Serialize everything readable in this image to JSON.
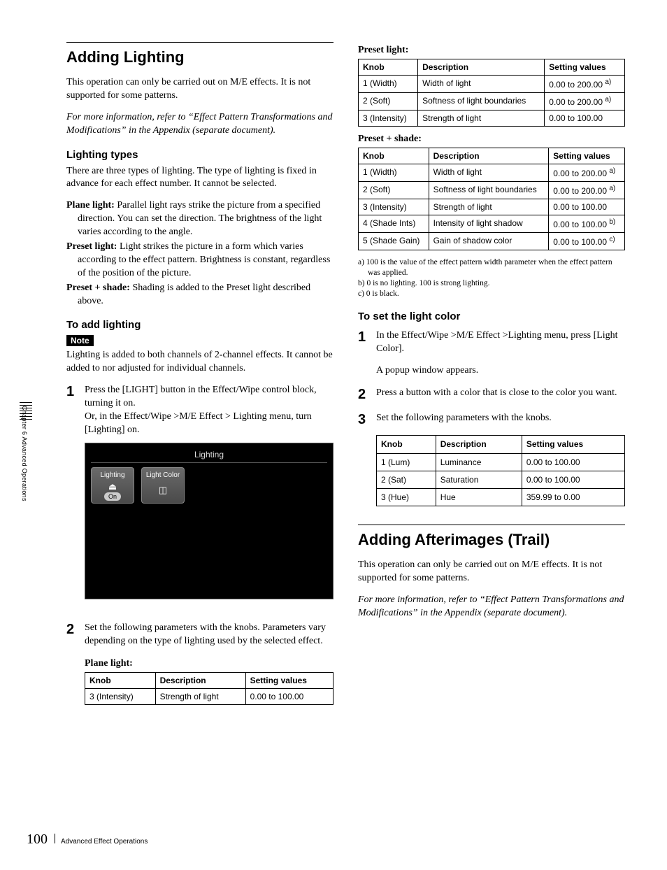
{
  "page_number": "100",
  "footer_text": "Advanced Effect Operations",
  "side_tab": "Chapter 6   Advanced Operations",
  "left": {
    "section_title": "Adding Lighting",
    "intro1": "This operation can only be carried out on M/E effects. It is not supported for some patterns.",
    "intro_italic": "For more information, refer to “Effect Pattern Transformations and Modifications” in the Appendix (separate document).",
    "lighting_types_title": "Lighting types",
    "lighting_types_intro": "There are three types of lighting. The type of lighting is fixed in advance for each effect number. It cannot be selected.",
    "defs": [
      {
        "term": "Plane light:",
        "desc": " Parallel light rays strike the picture from a specified direction. You can set the direction. The brightness of the light varies according to the angle."
      },
      {
        "term": "Preset light:",
        "desc": " Light strikes the picture in a form which varies according to the effect pattern. Brightness is constant, regardless of the position of the picture."
      },
      {
        "term": "Preset + shade:",
        "desc": " Shading is added to the Preset light described above."
      }
    ],
    "to_add_title": "To add lighting",
    "note_label": "Note",
    "note_body": "Lighting is added to both channels of 2-channel effects. It cannot be added to nor adjusted for individual channels.",
    "step1_a": "Press the [LIGHT] button in the Effect/Wipe control block, turning it on.",
    "step1_b": "Or, in the Effect/Wipe >M/E Effect > Lighting menu, turn [Lighting] on.",
    "ui": {
      "title": "Lighting",
      "btn1_label": "Lighting",
      "btn1_state": "On",
      "btn2_label": "Light Color"
    },
    "step2": "Set the following parameters with the knobs. Parameters vary depending on the type of lighting used by the selected effect.",
    "plane_caption": "Plane light:",
    "table_headers": [
      "Knob",
      "Description",
      "Setting values"
    ],
    "plane_rows": [
      {
        "k": "3 (Intensity)",
        "d": "Strength of light",
        "v": "0.00 to 100.00"
      }
    ]
  },
  "right": {
    "preset_caption": "Preset light:",
    "preset_rows": [
      {
        "k": "1 (Width)",
        "d": "Width of light",
        "v": "0.00 to 200.00 ",
        "sup": "a)"
      },
      {
        "k": "2 (Soft)",
        "d": "Softness of light boundaries",
        "v": "0.00 to 200.00 ",
        "sup": "a)"
      },
      {
        "k": "3 (Intensity)",
        "d": "Strength of light",
        "v": "0.00 to 100.00"
      }
    ],
    "preset_shade_caption": "Preset + shade:",
    "preset_shade_rows": [
      {
        "k": "1 (Width)",
        "d": "Width of light",
        "v": "0.00 to 200.00 ",
        "sup": "a)"
      },
      {
        "k": "2 (Soft)",
        "d": "Softness of light boundaries",
        "v": "0.00 to 200.00 ",
        "sup": "a)"
      },
      {
        "k": "3 (Intensity)",
        "d": "Strength of light",
        "v": "0.00 to 100.00"
      },
      {
        "k": "4 (Shade Ints)",
        "d": "Intensity of light shadow",
        "v": "0.00 to 100.00 ",
        "sup": "b)"
      },
      {
        "k": "5 (Shade Gain)",
        "d": "Gain of shadow color",
        "v": "0.00 to 100.00 ",
        "sup": "c)"
      }
    ],
    "footnotes": [
      "a) 100 is the value of the effect pattern width parameter when the effect pattern was applied.",
      "b) 0 is no lighting. 100 is strong lighting.",
      "c) 0 is black."
    ],
    "light_color_title": "To set the light color",
    "lc_step1": "In the Effect/Wipe >M/E Effect >Lighting menu, press [Light Color].",
    "lc_step1b": "A popup window appears.",
    "lc_step2": "Press a button with a color that is close to the color you want.",
    "lc_step3": "Set the following parameters with the knobs.",
    "color_rows": [
      {
        "k": "1 (Lum)",
        "d": "Luminance",
        "v": "0.00 to 100.00"
      },
      {
        "k": "2 (Sat)",
        "d": "Saturation",
        "v": "0.00 to 100.00"
      },
      {
        "k": "3 (Hue)",
        "d": "Hue",
        "v": "359.99 to 0.00"
      }
    ],
    "afterimages_title": "Adding Afterimages (Trail)",
    "after_p1": "This operation can only be carried out on M/E effects. It is not supported for some patterns.",
    "after_italic": "For more information, refer to “Effect Pattern Transformations and Modifications” in the Appendix (separate document)."
  }
}
